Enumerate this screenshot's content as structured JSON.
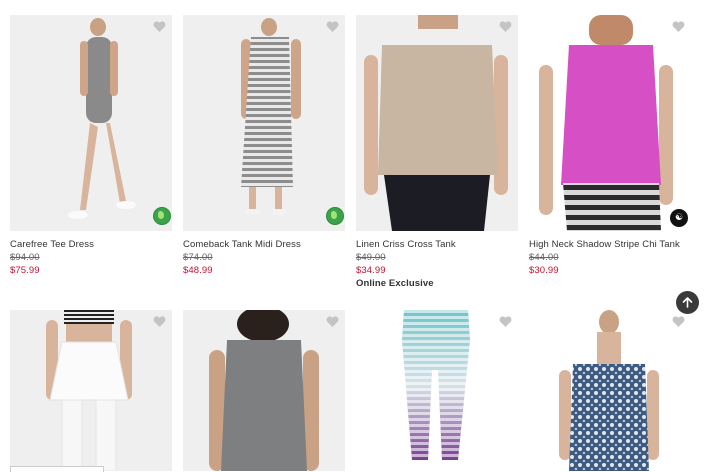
{
  "products_row1": [
    {
      "name": "Carefree Tee Dress",
      "original_price": "$94.00",
      "sale_price": "$75.99",
      "badge_icon": "eco-leaf-icon"
    },
    {
      "name": "Comeback Tank Midi Dress",
      "original_price": "$74.00",
      "sale_price": "$48.99",
      "badge_icon": "eco-leaf-icon"
    },
    {
      "name": "Linen Criss Cross Tank",
      "original_price": "$49.00",
      "sale_price": "$34.99",
      "tag": "Online Exclusive"
    },
    {
      "name": "High Neck Shadow Stripe Chi Tank",
      "original_price": "$44.00",
      "sale_price": "$30.99",
      "badge_icon": "yoga-figure-icon"
    }
  ],
  "products_row2": [
    {
      "image": "white-skirt-leggings"
    },
    {
      "image": "gray-racerback-tank"
    },
    {
      "image": "striped-capri-leggings"
    },
    {
      "image": "print-strapless-dress"
    }
  ],
  "icons": {
    "favorite": "heart-icon",
    "scroll_top": "arrow-up-icon"
  },
  "colors": {
    "sale": "#c8102e",
    "text": "#333333",
    "image_bg": "#efefef",
    "eco_badge": "#3ba44a"
  }
}
